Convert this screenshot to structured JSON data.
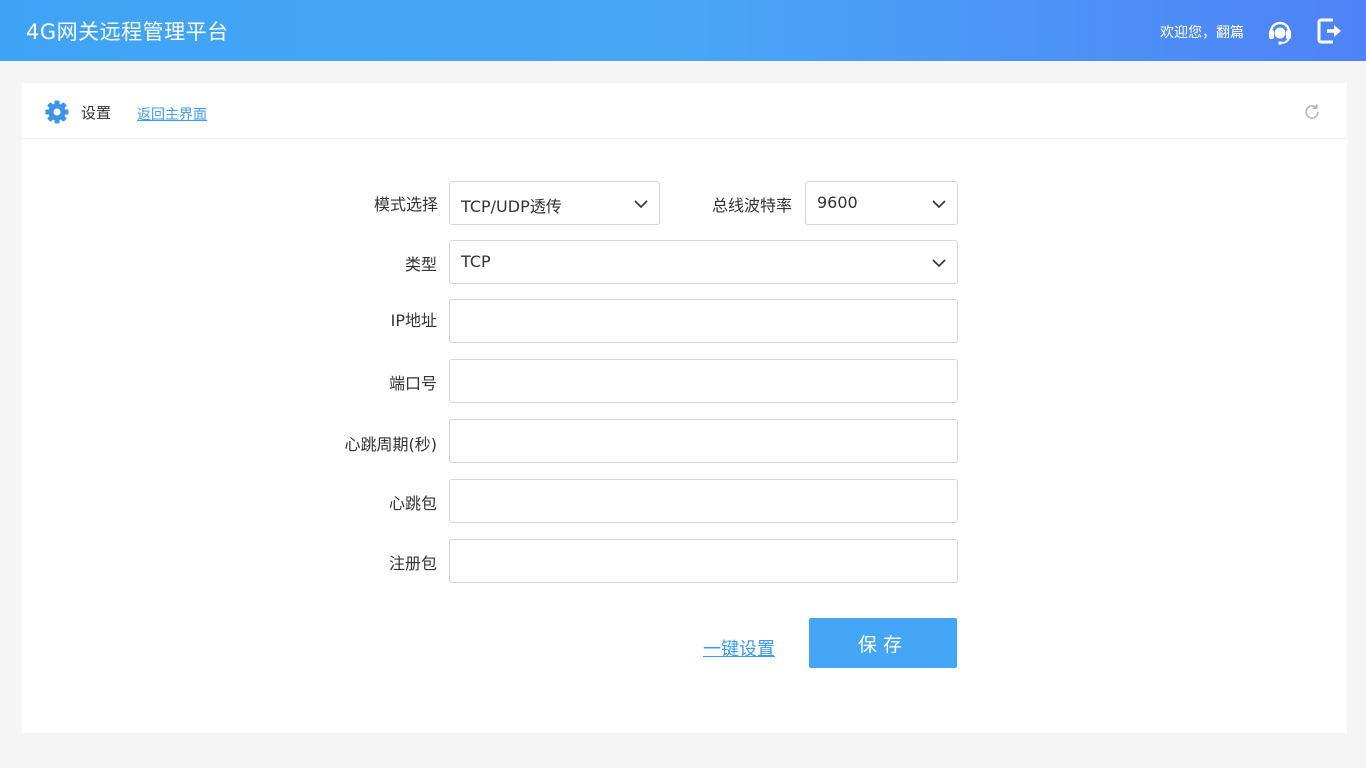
{
  "header": {
    "app_title": "4G网关远程管理平台",
    "welcome_text": "欢迎您，翻篇",
    "support_icon": "headset-support-icon",
    "logout_icon": "logout-icon"
  },
  "panel": {
    "title": "设置",
    "back_link": "返回主界面",
    "gear_icon": "gear-icon",
    "refresh_icon": "refresh-icon"
  },
  "form": {
    "mode": {
      "label": "模式选择",
      "value": "TCP/UDP透传"
    },
    "baud": {
      "label": "总线波特率",
      "value": "9600"
    },
    "type": {
      "label": "类型",
      "value": "TCP"
    },
    "ip": {
      "label": "IP地址",
      "value": ""
    },
    "port": {
      "label": "端口号",
      "value": ""
    },
    "heartbeat_period": {
      "label": "心跳周期(秒)",
      "value": ""
    },
    "heartbeat_packet": {
      "label": "心跳包",
      "value": ""
    },
    "register_packet": {
      "label": "注册包",
      "value": ""
    }
  },
  "actions": {
    "onekey_label": "一键设置",
    "save_label": "保存"
  },
  "colors": {
    "accent": "#45a5f6",
    "link": "#3b9cf2",
    "header_start": "#3fa3f5",
    "header_end": "#4f82f7"
  }
}
